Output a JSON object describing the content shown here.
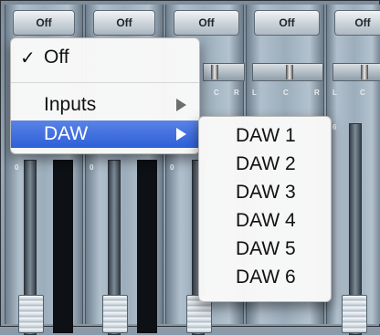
{
  "mixer": {
    "channels": [
      {
        "button_label": "Off"
      },
      {
        "button_label": "Off"
      },
      {
        "button_label": "Off"
      },
      {
        "button_label": "Off"
      },
      {
        "button_label": "Off"
      }
    ],
    "pan_labels": {
      "left": "L",
      "center": "C",
      "right": "R"
    },
    "scale_zero": "0",
    "scale_six": "6"
  },
  "source_menu": {
    "items": [
      {
        "label": "Off",
        "checked": true,
        "check_mark": "✓"
      },
      {
        "label": "Inputs",
        "has_submenu": true
      },
      {
        "label": "DAW",
        "has_submenu": true,
        "highlighted": true
      }
    ]
  },
  "daw_submenu": {
    "items": [
      "DAW 1",
      "DAW 2",
      "DAW 3",
      "DAW 4",
      "DAW 5",
      "DAW 6"
    ]
  },
  "colors": {
    "highlight": "#2d5fd8",
    "menu_background": "#f8f8f8",
    "mixer_background": "#9aa9b6"
  }
}
